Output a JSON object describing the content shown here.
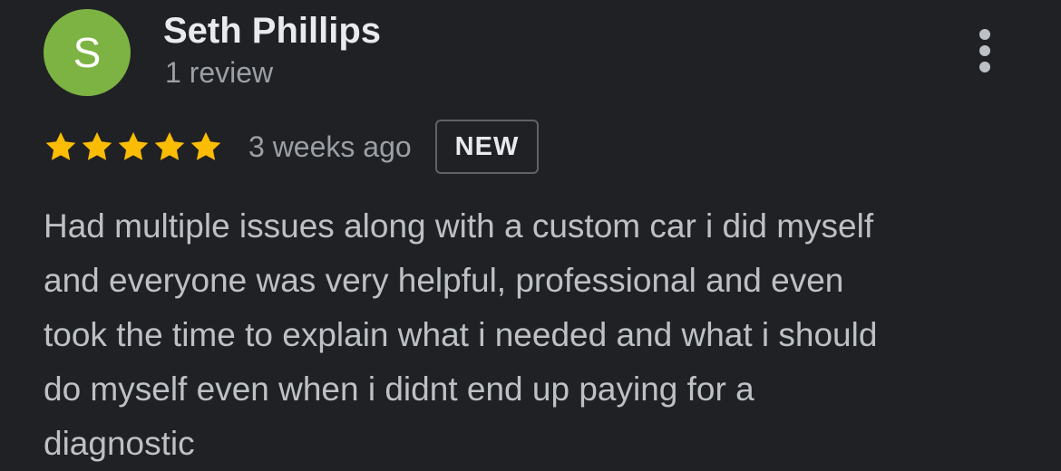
{
  "review": {
    "avatar": {
      "initial": "S",
      "color": "#7cb342"
    },
    "author_name": "Seth Phillips",
    "review_count": "1 review",
    "more_options_icon": "more-vert-icon",
    "rating": {
      "stars": 5,
      "max": 5,
      "star_color": "#fbbc04"
    },
    "time_ago": "3 weeks ago",
    "badge": "NEW",
    "text": "Had multiple issues along with a custom car i did myself\nand everyone was very helpful, professional and even\ntook the time to explain what i needed and what i should\ndo myself even when i didnt end up paying for a\ndiagnostic"
  }
}
